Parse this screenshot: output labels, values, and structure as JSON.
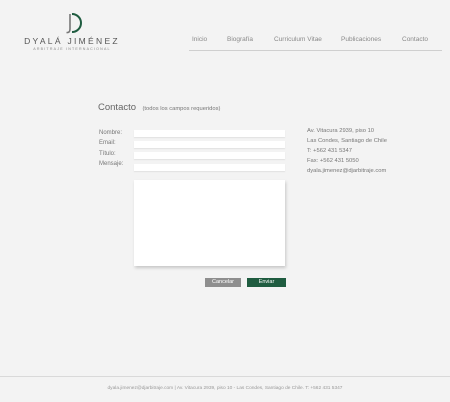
{
  "brand": {
    "name": "DYALÁ JIMÉNEZ",
    "tagline": "ARBITRAJE INTERNACIONAL",
    "accent": "#1f5c40"
  },
  "nav": [
    {
      "label": "Inicio"
    },
    {
      "label": "Biografía"
    },
    {
      "label": "Curriculum Vitae"
    },
    {
      "label": "Publicaciones"
    },
    {
      "label": "Contacto"
    }
  ],
  "contact": {
    "title": "Contacto",
    "subtitle": "(todos los campos requeridos)",
    "labels": {
      "nombre": "Nombre:",
      "email": "Email:",
      "titulo": "Título:",
      "mensaje": "Mensaje:"
    },
    "values": {
      "nombre": "",
      "email": "",
      "titulo": "",
      "mensaje": ""
    },
    "buttons": {
      "cancel": "Cancelar",
      "send": "Enviar"
    }
  },
  "info": {
    "address": "Av. Vitacura 2939, piso 10",
    "city": "Las Condes, Santiago de Chile",
    "phone": "T:  +562 431 5347",
    "fax": "Fax:  +562 431 5050",
    "email": "dyala.jimenez@djarbitraje.com"
  },
  "footer": "dyala.jimenez@djarbitraje.com  |  Av. Vitacura 2939, piso 10 - Las Condes, Santiago de Chile. T: +562 431 5347"
}
